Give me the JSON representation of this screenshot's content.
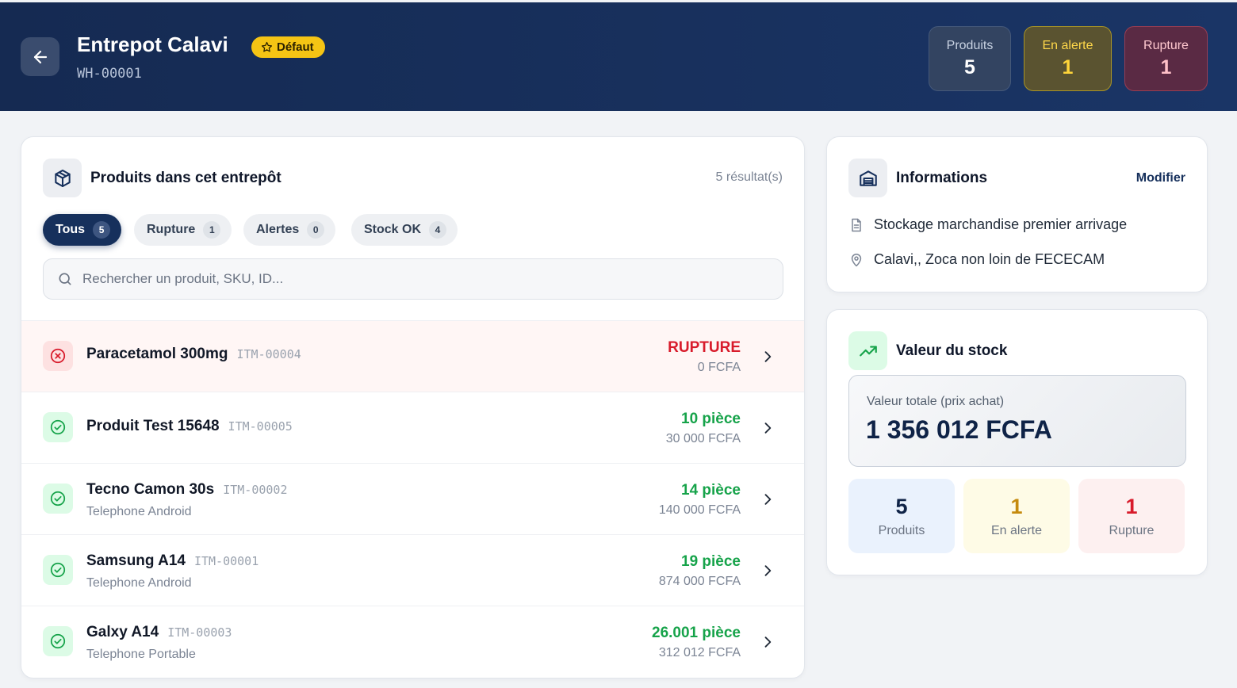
{
  "header": {
    "back_icon": "arrow-left-icon",
    "title": "Entrepot Calavi",
    "badge": "Défaut",
    "badge_icon": "star-icon",
    "code": "WH-00001",
    "stats": {
      "products_label": "Produits",
      "products_value": "5",
      "alert_label": "En alerte",
      "alert_value": "1",
      "rupture_label": "Rupture",
      "rupture_value": "1"
    }
  },
  "products": {
    "icon": "package-icon",
    "title": "Produits dans cet entrepôt",
    "result_count": "5 résultat(s)",
    "filters": [
      {
        "label": "Tous",
        "count": "5",
        "active": true
      },
      {
        "label": "Rupture",
        "count": "1",
        "active": false
      },
      {
        "label": "Alertes",
        "count": "0",
        "active": false
      },
      {
        "label": "Stock OK",
        "count": "4",
        "active": false
      }
    ],
    "search_placeholder": "Rechercher un produit, SKU, ID...",
    "items": [
      {
        "name": "Paracetamol 300mg",
        "sku": "ITM-00004",
        "category": "",
        "qty": "RUPTURE",
        "price": "0 FCFA",
        "status": "rupture"
      },
      {
        "name": "Produit Test 15648",
        "sku": "ITM-00005",
        "category": "",
        "qty": "10 pièce",
        "price": "30 000 FCFA",
        "status": "ok"
      },
      {
        "name": "Tecno Camon 30s",
        "sku": "ITM-00002",
        "category": "Telephone Android",
        "qty": "14 pièce",
        "price": "140 000 FCFA",
        "status": "ok"
      },
      {
        "name": "Samsung A14",
        "sku": "ITM-00001",
        "category": "Telephone Android",
        "qty": "19 pièce",
        "price": "874 000 FCFA",
        "status": "ok"
      },
      {
        "name": "Galxy A14",
        "sku": "ITM-00003",
        "category": "Telephone Portable",
        "qty": "26.001 pièce",
        "price": "312 012 FCFA",
        "status": "ok"
      }
    ]
  },
  "info": {
    "icon": "warehouse-icon",
    "title": "Informations",
    "edit_label": "Modifier",
    "description": "Stockage marchandise premier arrivage",
    "description_icon": "document-icon",
    "address": "Calavi,, Zoca non loin de FECECAM",
    "address_icon": "map-pin-icon"
  },
  "stock_value": {
    "icon": "trending-up-icon",
    "title": "Valeur du stock",
    "total_label": "Valeur totale (prix achat)",
    "total_value": "1 356 012 FCFA",
    "products_value": "5",
    "products_label": "Produits",
    "alert_value": "1",
    "alert_label": "En alerte",
    "rupture_value": "1",
    "rupture_label": "Rupture"
  },
  "colors": {
    "header_bg": "#152a52",
    "accent": "#16305c",
    "danger": "#d81b2b",
    "success": "#16a34a",
    "warning": "#f5c414"
  }
}
